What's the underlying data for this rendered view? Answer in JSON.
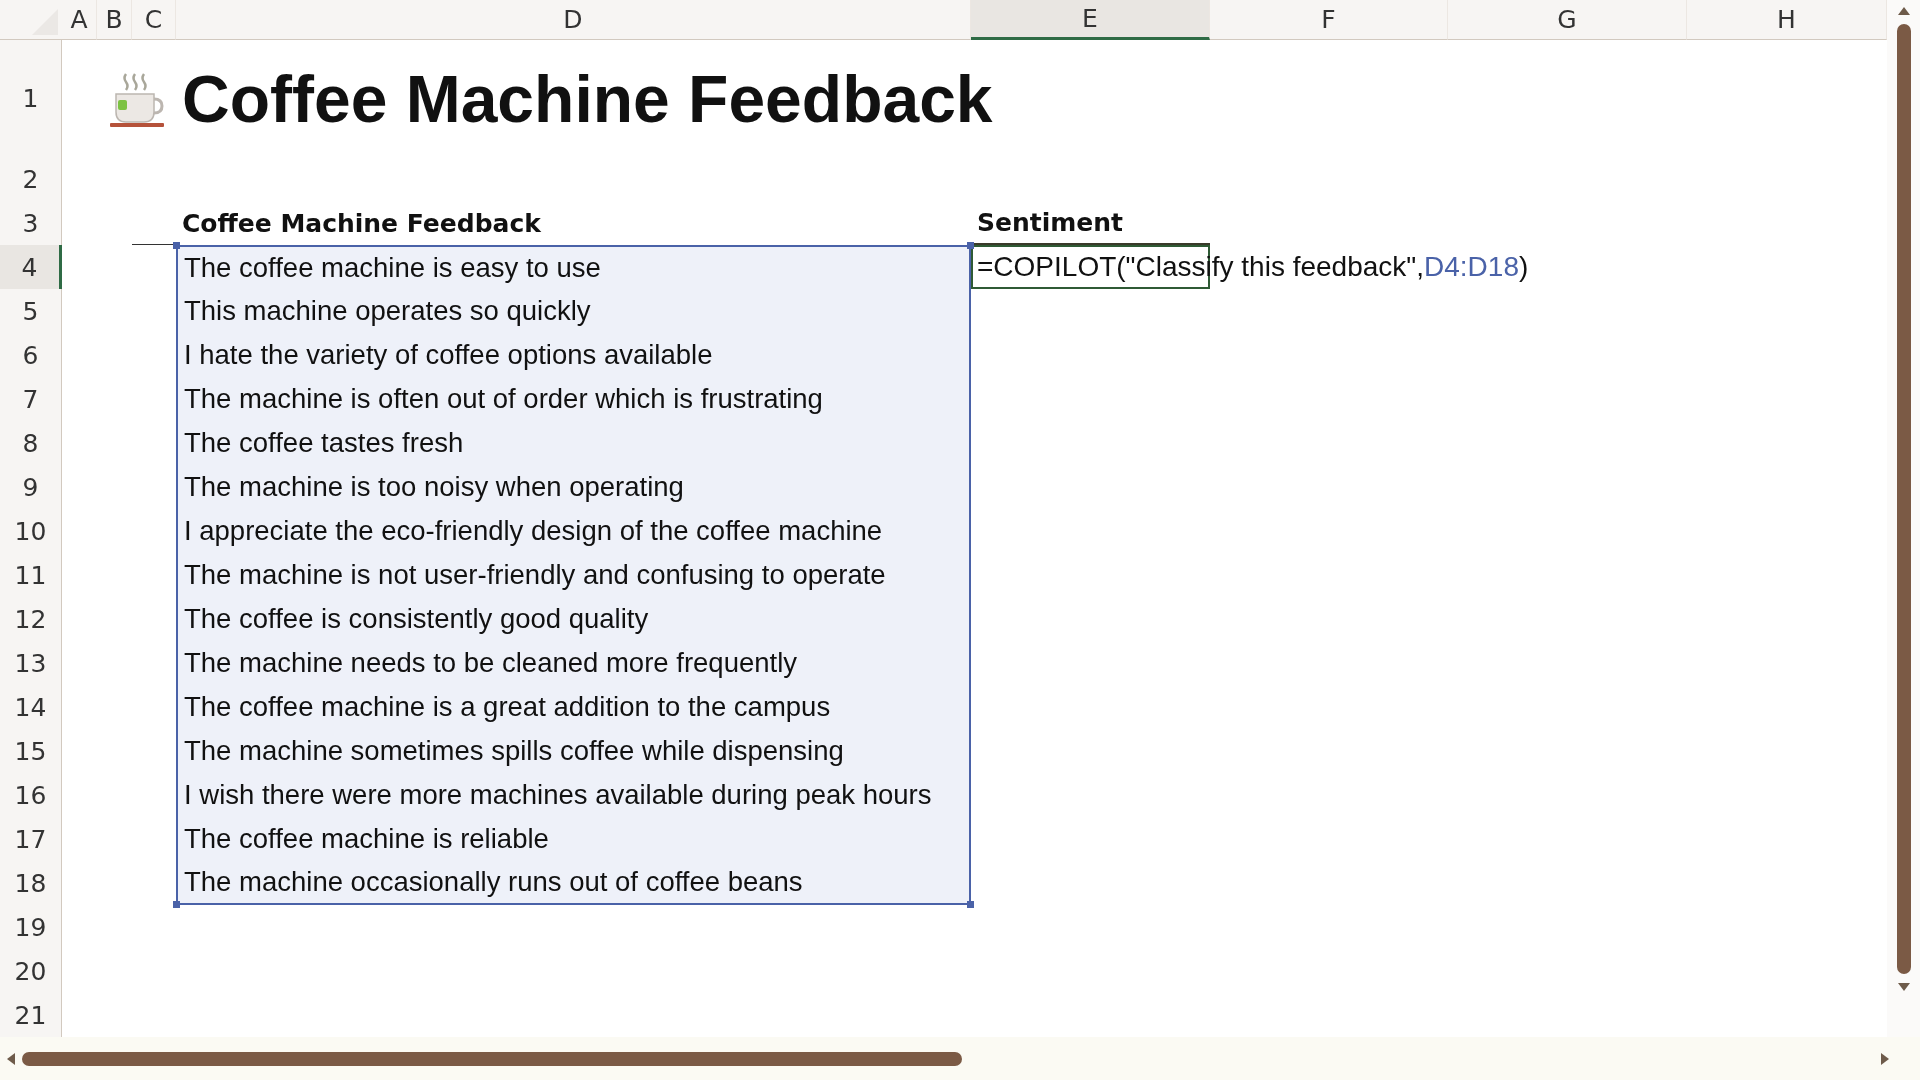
{
  "columns": [
    {
      "label": "A",
      "selected": false
    },
    {
      "label": "B",
      "selected": false
    },
    {
      "label": "C",
      "selected": false
    },
    {
      "label": "D",
      "selected": false
    },
    {
      "label": "E",
      "selected": true
    },
    {
      "label": "F",
      "selected": false
    },
    {
      "label": "G",
      "selected": false
    },
    {
      "label": "H",
      "selected": false
    }
  ],
  "row_numbers": [
    {
      "label": "1",
      "selected": false
    },
    {
      "label": "2",
      "selected": false
    },
    {
      "label": "3",
      "selected": false
    },
    {
      "label": "4",
      "selected": true
    },
    {
      "label": "5",
      "selected": false
    },
    {
      "label": "6",
      "selected": false
    },
    {
      "label": "7",
      "selected": false
    },
    {
      "label": "8",
      "selected": false
    },
    {
      "label": "9",
      "selected": false
    },
    {
      "label": "10",
      "selected": false
    },
    {
      "label": "11",
      "selected": false
    },
    {
      "label": "12",
      "selected": false
    },
    {
      "label": "13",
      "selected": false
    },
    {
      "label": "14",
      "selected": false
    },
    {
      "label": "15",
      "selected": false
    },
    {
      "label": "16",
      "selected": false
    },
    {
      "label": "17",
      "selected": false
    },
    {
      "label": "18",
      "selected": false
    },
    {
      "label": "19",
      "selected": false
    },
    {
      "label": "20",
      "selected": false
    },
    {
      "label": "21",
      "selected": false
    }
  ],
  "title": "Coffee Machine Feedback",
  "table": {
    "columns": [
      "Coffee Machine Feedback",
      "Sentiment"
    ],
    "formula": {
      "text": "=COPILOT(\"Classify this feedback\",",
      "reference": "D4:D18",
      "suffix": ")",
      "active": true
    },
    "rows": [
      {
        "feedback": "The coffee machine is easy to use",
        "in_selection": true
      },
      {
        "feedback": "This machine operates so quickly",
        "in_selection": true
      },
      {
        "feedback": "I hate the variety of coffee options available",
        "in_selection": true
      },
      {
        "feedback": "The machine is often out of order which is frustrating",
        "in_selection": true
      },
      {
        "feedback": "The coffee tastes fresh",
        "in_selection": true
      },
      {
        "feedback": "The machine is too noisy when operating",
        "in_selection": true
      },
      {
        "feedback": "I appreciate the eco-friendly design of the coffee machine",
        "in_selection": true
      },
      {
        "feedback": "The machine is not user-friendly and confusing to operate",
        "in_selection": true
      },
      {
        "feedback": "The coffee is consistently good quality",
        "in_selection": true
      },
      {
        "feedback": "The machine needs to be cleaned more frequently",
        "in_selection": true
      },
      {
        "feedback": "The coffee machine is a great addition to the campus",
        "in_selection": true
      },
      {
        "feedback": "The machine sometimes spills coffee while dispensing",
        "in_selection": true
      },
      {
        "feedback": "I wish there were more machines available during peak hours",
        "in_selection": true
      },
      {
        "feedback": "The coffee machine is reliable",
        "in_selection": true
      },
      {
        "feedback": "The machine occasionally runs out of coffee beans",
        "in_selection": true
      }
    ]
  }
}
